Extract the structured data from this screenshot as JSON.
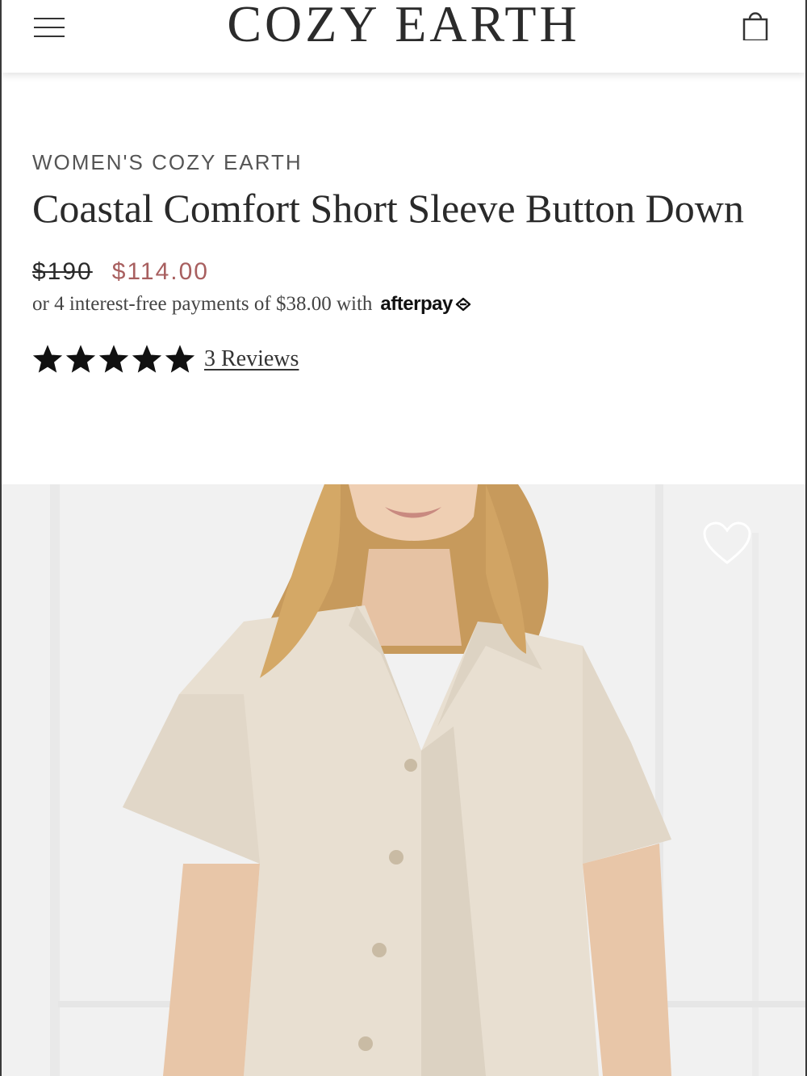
{
  "header": {
    "brand": "COZY EARTH",
    "menu_icon": "hamburger-menu-icon",
    "bag_icon": "shopping-bag-icon"
  },
  "product": {
    "collection": "WOMEN'S COZY EARTH",
    "title": "Coastal Comfort Short Sleeve Button Down",
    "original_price": "$190",
    "sale_price": "$114.00",
    "installments_text": "or 4 interest-free payments of $38.00 with",
    "installments_provider": "afterpay",
    "rating": 5,
    "rating_max": 5,
    "reviews_label": "3 Reviews",
    "wishlist_icon": "heart-icon"
  },
  "colors": {
    "sale_price": "#a85f5f",
    "text": "#2a2a2a",
    "shirt": "#e8dfd1"
  }
}
